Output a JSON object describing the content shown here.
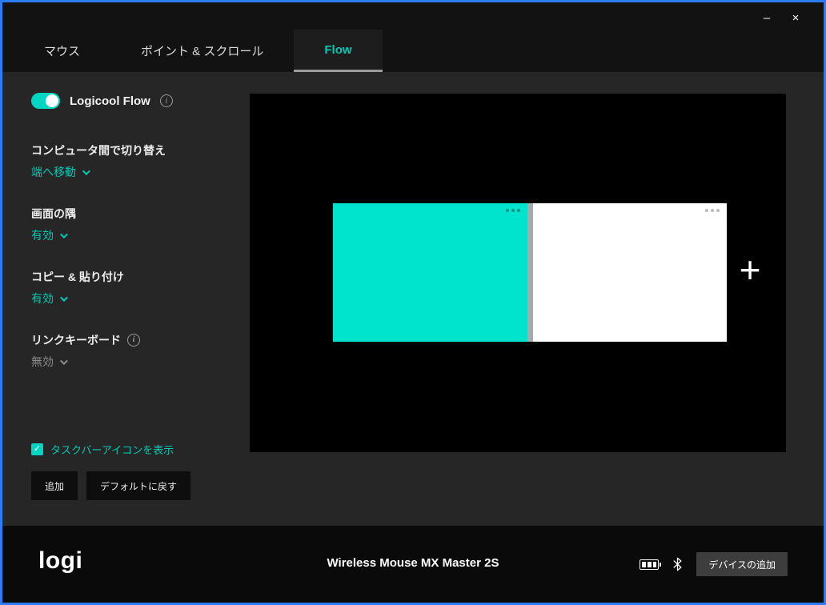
{
  "window": {
    "minimize_glyph": "–",
    "close_glyph": "×"
  },
  "tabs": [
    {
      "label": "マウス",
      "active": false
    },
    {
      "label": "ポイント & スクロール",
      "active": false
    },
    {
      "label": "Flow",
      "active": true
    }
  ],
  "sidebar": {
    "flow_toggle_label": "Logicool Flow",
    "flow_toggle_on": true,
    "sections": [
      {
        "title": "コンピュータ間で切り替え",
        "value": "端へ移動",
        "disabled": false
      },
      {
        "title": "画面の隅",
        "value": "有効",
        "disabled": false
      },
      {
        "title": "コピー & 貼り付け",
        "value": "有効",
        "disabled": false
      },
      {
        "title": "リンクキーボード",
        "value": "無効",
        "disabled": true
      }
    ],
    "taskbar_checkbox": {
      "label": "タスクバーアイコンを表示",
      "checked": true
    },
    "add_button_label": "追加",
    "restore_button_label": "デフォルトに戻す"
  },
  "canvas": {
    "plus_glyph": "+"
  },
  "footer": {
    "logo_text": "logi",
    "device_name": "Wireless Mouse MX Master 2S",
    "add_device_label": "デバイスの追加"
  },
  "icons": {
    "info_glyph": "i",
    "check_glyph": "✓"
  },
  "colors": {
    "accent": "#00c9b4",
    "accent_bright": "#00e3cd",
    "window_border": "#2b7cf7",
    "canvas_bg": "#000000"
  }
}
